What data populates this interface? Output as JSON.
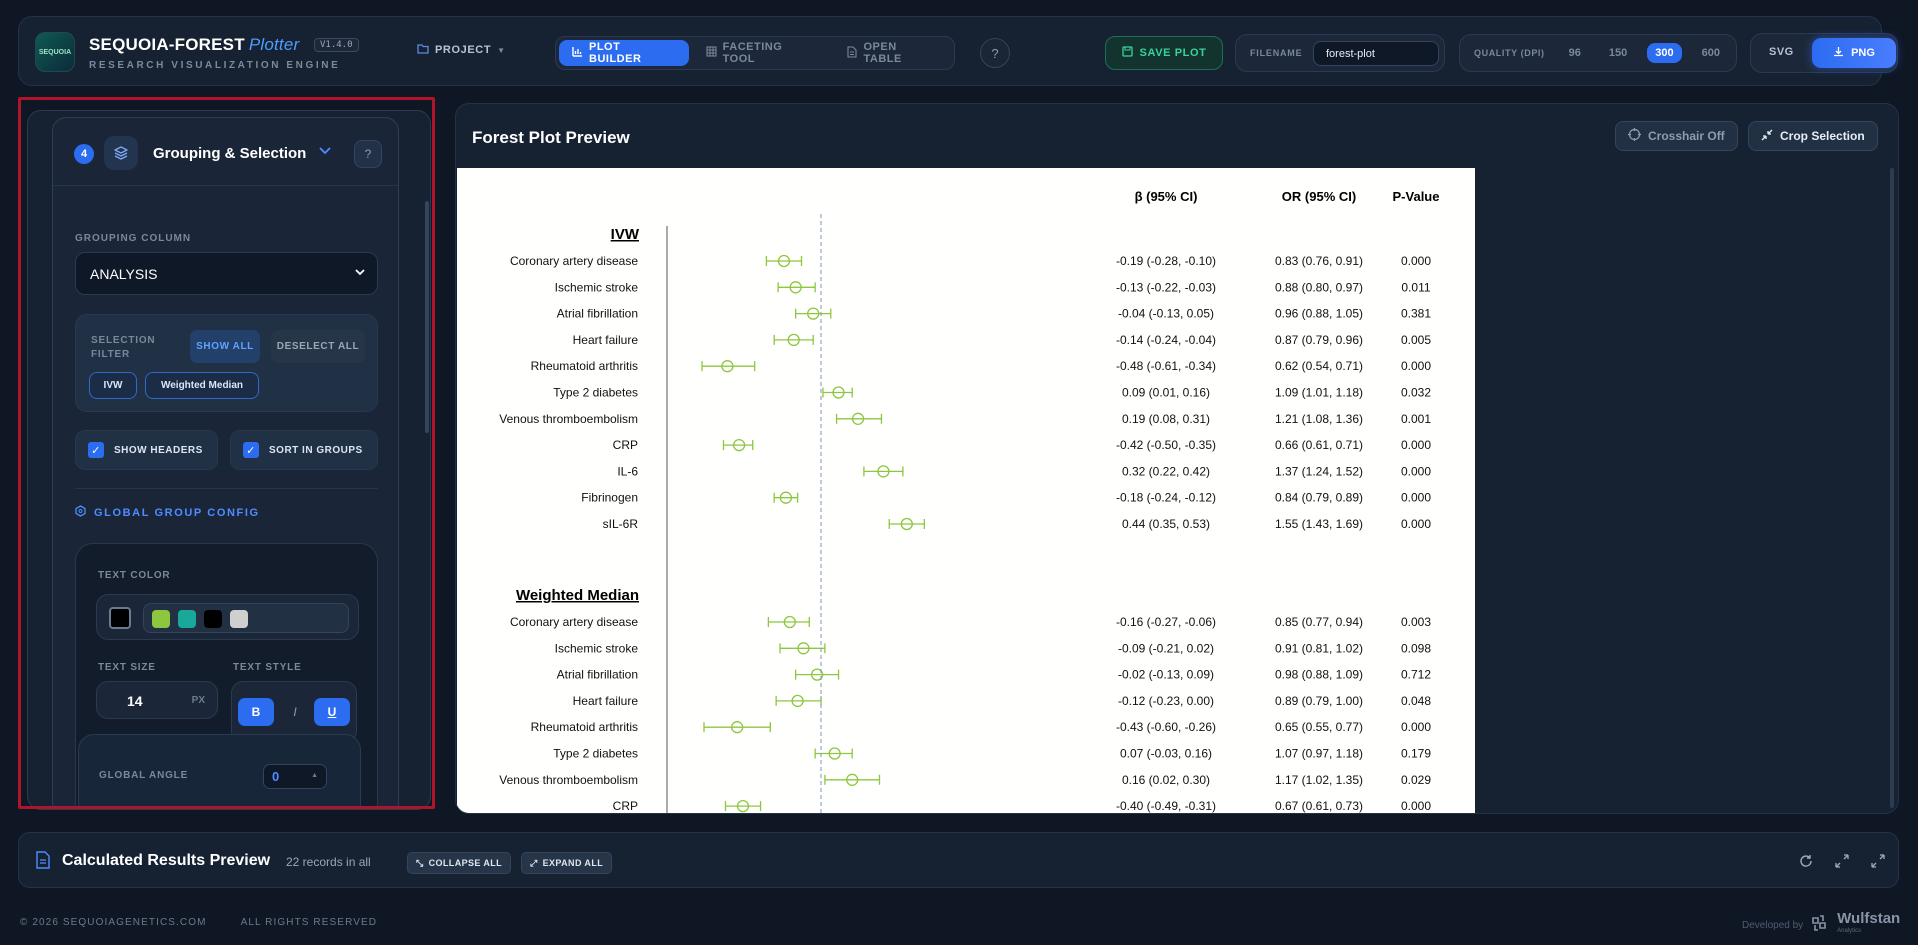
{
  "header": {
    "logo_text": "SEQUOIA",
    "brand_name": "SEQUOIA-FOREST",
    "brand_sub": "Plotter",
    "version": "V1.4.0",
    "tagline": "RESEARCH VISUALIZATION ENGINE",
    "project_label": "PROJECT",
    "tabs": [
      {
        "label": "PLOT BUILDER",
        "active": true
      },
      {
        "label": "FACETING TOOL",
        "active": false
      },
      {
        "label": "OPEN TABLE",
        "active": false
      }
    ],
    "save_label": "SAVE PLOT",
    "filename_label": "FILENAME",
    "filename_value": "forest-plot",
    "quality_label": "QUALITY (DPI)",
    "quality_options": [
      "96",
      "150",
      "300",
      "600"
    ],
    "quality_selected": "300",
    "format_svg": "SVG",
    "format_png": "PNG"
  },
  "panel": {
    "step": "4",
    "title": "Grouping & Selection",
    "grouping_label": "GROUPING COLUMN",
    "grouping_value": "ANALYSIS",
    "filter_label": "SELECTION FILTER",
    "show_all": "SHOW ALL",
    "deselect_all": "DESELECT ALL",
    "chips": [
      "IVW",
      "Weighted Median"
    ],
    "show_headers": "SHOW HEADERS",
    "sort_in_groups": "SORT IN GROUPS",
    "global_config_title": "GLOBAL GROUP CONFIG",
    "text_color_label": "TEXT COLOR",
    "swatches": [
      "#8dc63f",
      "#1aa89a",
      "#000000",
      "#cfcfcf"
    ],
    "current_color": "#000000",
    "text_size_label": "TEXT SIZE",
    "text_size_value": "14",
    "text_size_unit": "PX",
    "text_style_label": "TEXT STYLE",
    "style_bold": "B",
    "style_italic": "I",
    "style_underline": "U",
    "global_angle_label": "GLOBAL ANGLE",
    "global_angle_value": "0"
  },
  "plot": {
    "title": "Forest Plot Preview",
    "crosshair_label": "Crosshair Off",
    "crop_label": "Crop Selection"
  },
  "chart_data": {
    "type": "forest",
    "columns": [
      "β (95% CI)",
      "OR (95% CI)",
      "P-Value"
    ],
    "reference_line": 0,
    "xlim": [
      -0.6,
      0.6
    ],
    "marker_color": "#8dc63f",
    "groups": [
      {
        "name": "IVW",
        "rows": [
          {
            "label": "Coronary artery disease",
            "beta": -0.19,
            "lo": -0.28,
            "hi": -0.1,
            "beta_text": "-0.19 (-0.28, -0.10)",
            "or_text": "0.83 (0.76, 0.91)",
            "p": "0.000"
          },
          {
            "label": "Ischemic stroke",
            "beta": -0.13,
            "lo": -0.22,
            "hi": -0.03,
            "beta_text": "-0.13 (-0.22, -0.03)",
            "or_text": "0.88 (0.80, 0.97)",
            "p": "0.011"
          },
          {
            "label": "Atrial fibrillation",
            "beta": -0.04,
            "lo": -0.13,
            "hi": 0.05,
            "beta_text": "-0.04 (-0.13, 0.05)",
            "or_text": "0.96 (0.88, 1.05)",
            "p": "0.381"
          },
          {
            "label": "Heart failure",
            "beta": -0.14,
            "lo": -0.24,
            "hi": -0.04,
            "beta_text": "-0.14 (-0.24, -0.04)",
            "or_text": "0.87 (0.79, 0.96)",
            "p": "0.005"
          },
          {
            "label": "Rheumatoid arthritis",
            "beta": -0.48,
            "lo": -0.61,
            "hi": -0.34,
            "beta_text": "-0.48 (-0.61, -0.34)",
            "or_text": "0.62 (0.54, 0.71)",
            "p": "0.000"
          },
          {
            "label": "Type 2 diabetes",
            "beta": 0.09,
            "lo": 0.01,
            "hi": 0.16,
            "beta_text": "0.09 (0.01, 0.16)",
            "or_text": "1.09 (1.01, 1.18)",
            "p": "0.032"
          },
          {
            "label": "Venous thromboembolism",
            "beta": 0.19,
            "lo": 0.08,
            "hi": 0.31,
            "beta_text": "0.19 (0.08, 0.31)",
            "or_text": "1.21 (1.08, 1.36)",
            "p": "0.001"
          },
          {
            "label": "CRP",
            "beta": -0.42,
            "lo": -0.5,
            "hi": -0.35,
            "beta_text": "-0.42 (-0.50, -0.35)",
            "or_text": "0.66 (0.61, 0.71)",
            "p": "0.000"
          },
          {
            "label": "IL-6",
            "beta": 0.32,
            "lo": 0.22,
            "hi": 0.42,
            "beta_text": "0.32 (0.22, 0.42)",
            "or_text": "1.37 (1.24, 1.52)",
            "p": "0.000"
          },
          {
            "label": "Fibrinogen",
            "beta": -0.18,
            "lo": -0.24,
            "hi": -0.12,
            "beta_text": "-0.18 (-0.24, -0.12)",
            "or_text": "0.84 (0.79, 0.89)",
            "p": "0.000"
          },
          {
            "label": "sIL-6R",
            "beta": 0.44,
            "lo": 0.35,
            "hi": 0.53,
            "beta_text": "0.44 (0.35, 0.53)",
            "or_text": "1.55 (1.43, 1.69)",
            "p": "0.000"
          }
        ]
      },
      {
        "name": "Weighted Median",
        "rows": [
          {
            "label": "Coronary artery disease",
            "beta": -0.16,
            "lo": -0.27,
            "hi": -0.06,
            "beta_text": "-0.16 (-0.27, -0.06)",
            "or_text": "0.85 (0.77, 0.94)",
            "p": "0.003"
          },
          {
            "label": "Ischemic stroke",
            "beta": -0.09,
            "lo": -0.21,
            "hi": 0.02,
            "beta_text": "-0.09 (-0.21, 0.02)",
            "or_text": "0.91 (0.81, 1.02)",
            "p": "0.098"
          },
          {
            "label": "Atrial fibrillation",
            "beta": -0.02,
            "lo": -0.13,
            "hi": 0.09,
            "beta_text": "-0.02 (-0.13, 0.09)",
            "or_text": "0.98 (0.88, 1.09)",
            "p": "0.712"
          },
          {
            "label": "Heart failure",
            "beta": -0.12,
            "lo": -0.23,
            "hi": 0.0,
            "beta_text": "-0.12 (-0.23, 0.00)",
            "or_text": "0.89 (0.79, 1.00)",
            "p": "0.048"
          },
          {
            "label": "Rheumatoid arthritis",
            "beta": -0.43,
            "lo": -0.6,
            "hi": -0.26,
            "beta_text": "-0.43 (-0.60, -0.26)",
            "or_text": "0.65 (0.55, 0.77)",
            "p": "0.000"
          },
          {
            "label": "Type 2 diabetes",
            "beta": 0.07,
            "lo": -0.03,
            "hi": 0.16,
            "beta_text": "0.07 (-0.03, 0.16)",
            "or_text": "1.07 (0.97, 1.18)",
            "p": "0.179"
          },
          {
            "label": "Venous thromboembolism",
            "beta": 0.16,
            "lo": 0.02,
            "hi": 0.3,
            "beta_text": "0.16 (0.02, 0.30)",
            "or_text": "1.17 (1.02, 1.35)",
            "p": "0.029"
          },
          {
            "label": "CRP",
            "beta": -0.4,
            "lo": -0.49,
            "hi": -0.31,
            "beta_text": "-0.40 (-0.49, -0.31)",
            "or_text": "0.67 (0.61, 0.73)",
            "p": "0.000"
          }
        ]
      }
    ]
  },
  "results": {
    "title": "Calculated Results Preview",
    "count": "22 records in all",
    "collapse_all": "COLLAPSE ALL",
    "expand_all": "EXPAND ALL"
  },
  "footer": {
    "copyright": "© 2026 SEQUOIAGENETICS.COM",
    "rights": "ALL RIGHTS RESERVED",
    "developed_by": "Developed by",
    "dev_brand": "Wulfstan",
    "dev_brand_sub": "Analytics"
  }
}
